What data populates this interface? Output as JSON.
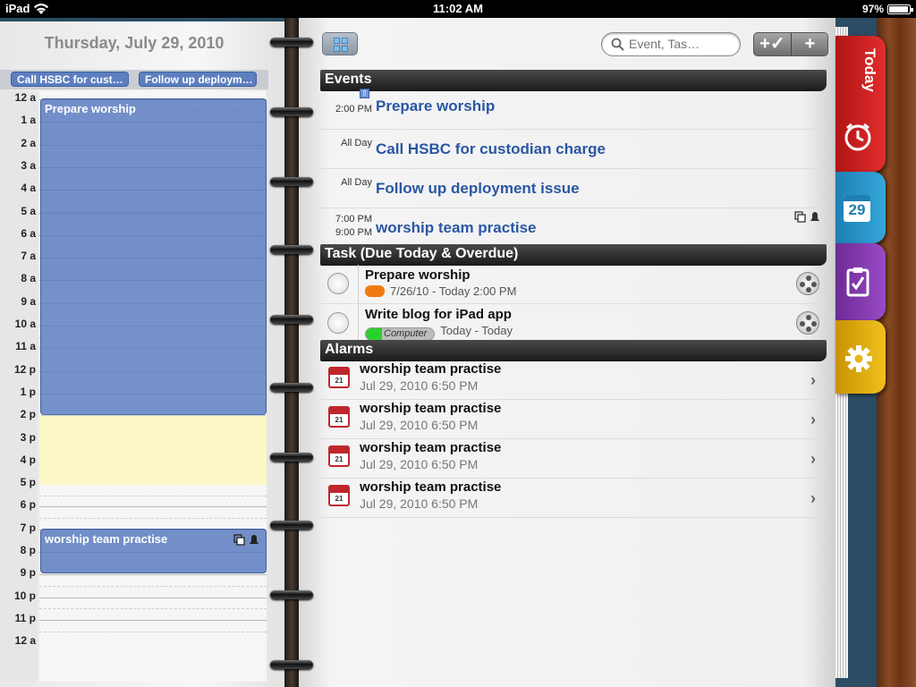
{
  "status": {
    "device": "iPad",
    "time": "11:02 AM",
    "battery": "97%"
  },
  "left": {
    "date_title": "Thursday, July 29, 2010",
    "allday_chips": [
      "Call HSBC for cust…",
      "Follow up deploym…"
    ],
    "hours": [
      "12 a",
      "1 a",
      "2 a",
      "3 a",
      "4 a",
      "5 a",
      "6 a",
      "7 a",
      "8 a",
      "9 a",
      "10 a",
      "11 a",
      "12 p",
      "1 p",
      "2 p",
      "3 p",
      "4 p",
      "5 p",
      "6 p",
      "7 p",
      "8 p",
      "9 p",
      "10 p",
      "11 p",
      "12 a"
    ],
    "events": [
      {
        "title": "Prepare worship"
      },
      {
        "title": "worship team practise"
      }
    ]
  },
  "toolbar": {
    "search_placeholder": "Event, Tas…",
    "add_task_label": "+✓",
    "add_label": "+"
  },
  "events_section": {
    "heading": "Events",
    "rows": [
      {
        "time1": "2:00 PM",
        "time2": "",
        "title": "Prepare worship"
      },
      {
        "time1": "All Day",
        "time2": "",
        "title": "Call HSBC for custodian charge"
      },
      {
        "time1": "All Day",
        "time2": "",
        "title": "Follow up deployment issue"
      },
      {
        "time1": "7:00 PM",
        "time2": "9:00 PM",
        "title": "worship team practise"
      }
    ]
  },
  "tasks_section": {
    "heading": "Task (Due Today & Overdue)",
    "rows": [
      {
        "title": "Prepare worship",
        "dates": "7/26/10 - Today 2:00 PM",
        "tag_color": "#f07a12"
      },
      {
        "title": "Write blog for iPad app",
        "context": "Computer",
        "dates": "Today - Today",
        "tag_color": "#2bd12b"
      }
    ]
  },
  "alarms_section": {
    "heading": "Alarms",
    "rows": [
      {
        "title": "worship team practise",
        "when": "Jul 29, 2010 6:50 PM"
      },
      {
        "title": "worship team practise",
        "when": "Jul 29, 2010 6:50 PM"
      },
      {
        "title": "worship team practise",
        "when": "Jul 29, 2010 6:50 PM"
      },
      {
        "title": "worship team practise",
        "when": "Jul 29, 2010 6:50 PM"
      }
    ],
    "calendar_icon_day": "21"
  },
  "tabs": {
    "today_label": "Today",
    "calendar_day": "29"
  },
  "colors": {
    "event_blue": "#5d7fc0",
    "title_blue": "#2a57a4",
    "today_red": "#d02222",
    "calendar_blue": "#2a93c8",
    "task_purple": "#8a3eb5",
    "settings_yellow": "#e8b514"
  }
}
